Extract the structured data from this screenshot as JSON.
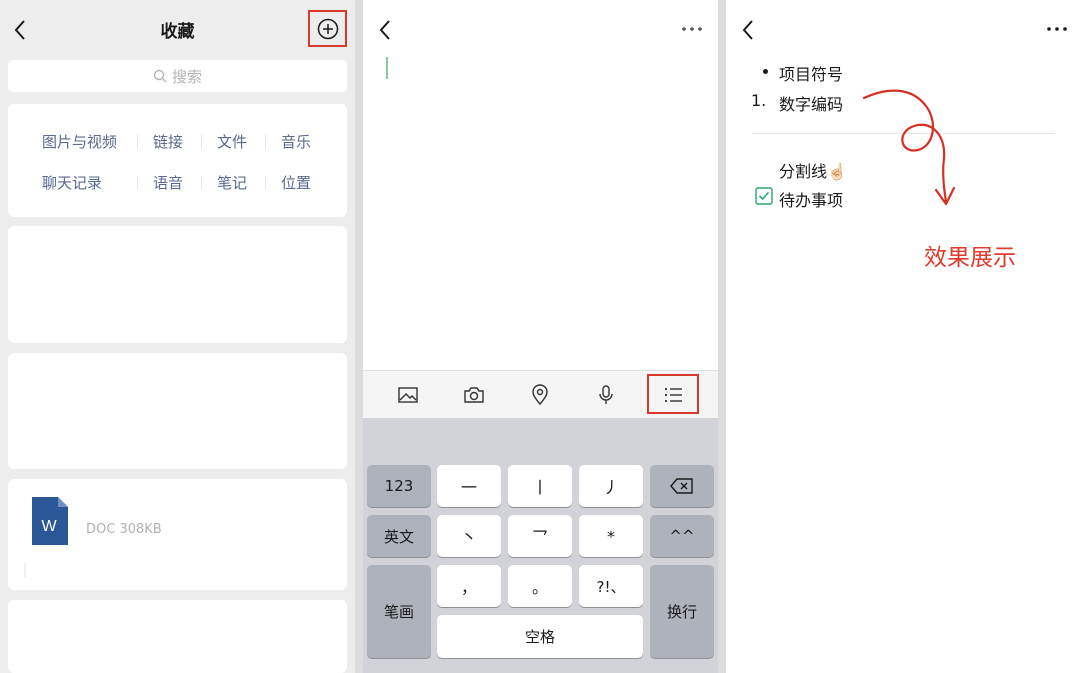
{
  "panel1": {
    "title": "收藏",
    "search_placeholder": "搜索",
    "categories_row1": [
      "图片与视频",
      "链接",
      "文件",
      "音乐"
    ],
    "categories_row2": [
      "聊天记录",
      "语音",
      "笔记",
      "位置"
    ],
    "doc_icon_letter": "W",
    "doc_meta": "DOC 308KB"
  },
  "panel2": {
    "more": "···",
    "keyboard": {
      "row1": [
        "123",
        "一",
        "丨",
        "丿"
      ],
      "row2": [
        "英文",
        "丶",
        "乛",
        "*",
        "^^"
      ],
      "row3": [
        "，",
        "。",
        "?!、"
      ],
      "left_bottom": "笔画",
      "space": "空格",
      "enter": "换行"
    }
  },
  "panel3": {
    "more": "···",
    "bullet_item": "项目符号",
    "number_prefix": "1.",
    "number_item": "数字编码",
    "divider_item": "分割线☝🏻",
    "todo_item": "待办事项",
    "annotation": "效果展示"
  },
  "colors": {
    "highlight_red": "#d53a2c",
    "link_blue": "#59698f",
    "word_blue": "#2b5797",
    "check_green": "#2aa56b"
  }
}
